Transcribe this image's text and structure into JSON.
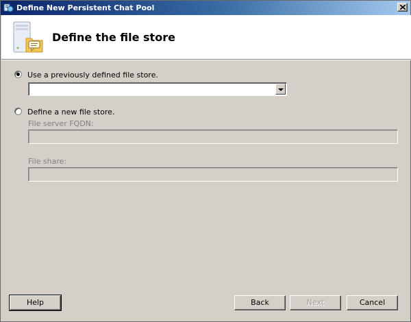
{
  "window": {
    "title": "Define New Persistent Chat Pool",
    "close_icon": "close-icon"
  },
  "header": {
    "title": "Define the file store",
    "icon": "file-store-chat-icon"
  },
  "options": {
    "existing": {
      "label": "Use a previously defined file store.",
      "selected": true,
      "value": ""
    },
    "new": {
      "label": "Define a new file store.",
      "selected": false,
      "fqdn_label": "File server FQDN:",
      "fqdn_value": "",
      "share_label": "File share:",
      "share_value": ""
    }
  },
  "buttons": {
    "help": "Help",
    "back": "Back",
    "next": "Next",
    "cancel": "Cancel"
  }
}
